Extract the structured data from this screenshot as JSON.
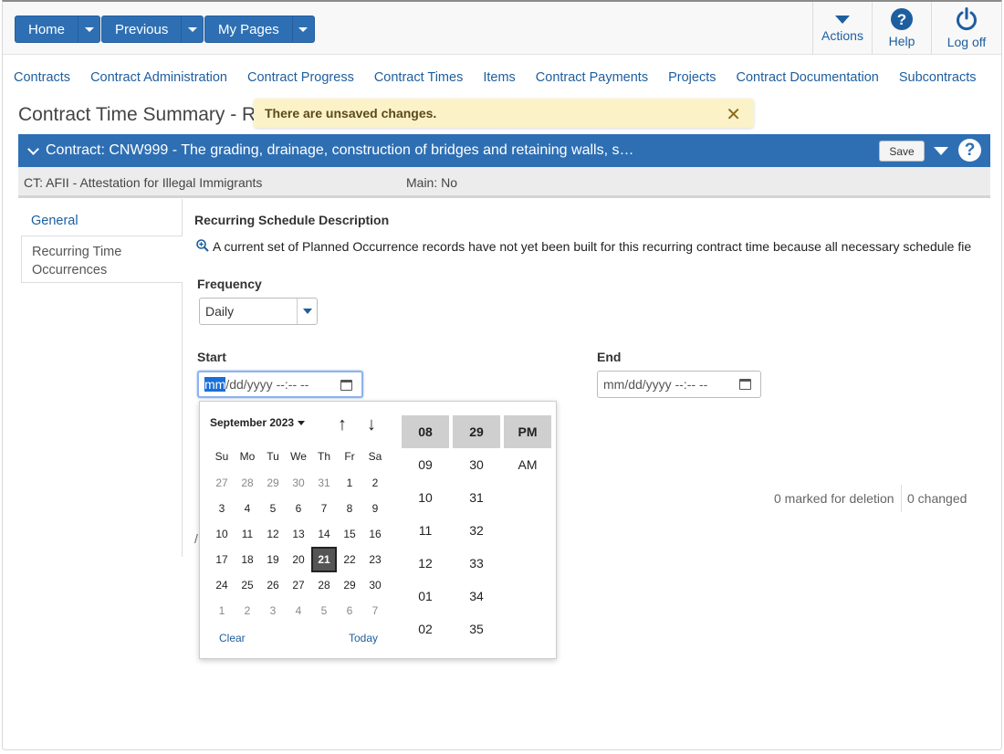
{
  "nav": {
    "home": "Home",
    "previous": "Previous",
    "my_pages": "My Pages",
    "actions": "Actions",
    "help": "Help",
    "logoff": "Log off"
  },
  "menu": [
    "Contracts",
    "Contract Administration",
    "Contract Progress",
    "Contract Times",
    "Items",
    "Contract Payments",
    "Projects",
    "Contract Documentation",
    "Subcontracts"
  ],
  "page_title": "Contract Time Summary - R",
  "toast": {
    "message": "There are unsaved changes.",
    "close": "✕"
  },
  "contract_bar": {
    "title": "Contract: CNW999 - The grading, drainage, construction of bridges and retaining walls, s…",
    "save": "Save",
    "help": "?"
  },
  "subbar": {
    "ct": "CT: AFII - Attestation for Illegal Immigrants",
    "main": "Main: No"
  },
  "side_tabs": [
    "General",
    "Recurring Time Occurrences"
  ],
  "content": {
    "section_label": "Recurring Schedule Description",
    "info_text": "A current set of Planned Occurrence records have not yet been built for this recurring contract time because all necessary schedule fie",
    "frequency_label": "Frequency",
    "frequency_value": "Daily",
    "start_label": "Start",
    "end_label": "End",
    "start_mm": "mm",
    "start_rest": "/dd/yyyy --:-- --",
    "end_placeholder": "mm/dd/yyyy --:-- --",
    "marked_for_deletion": "0 marked for deletion",
    "changed": "0 changed",
    "partial_char": "/"
  },
  "calendar": {
    "month": "September 2023",
    "up_arrow": "↑",
    "down_arrow": "↓",
    "dow": [
      "Su",
      "Mo",
      "Tu",
      "We",
      "Th",
      "Fr",
      "Sa"
    ],
    "weeks": [
      [
        "27",
        "28",
        "29",
        "30",
        "31",
        "1",
        "2"
      ],
      [
        "3",
        "4",
        "5",
        "6",
        "7",
        "8",
        "9"
      ],
      [
        "10",
        "11",
        "12",
        "13",
        "14",
        "15",
        "16"
      ],
      [
        "17",
        "18",
        "19",
        "20",
        "21",
        "22",
        "23"
      ],
      [
        "24",
        "25",
        "26",
        "27",
        "28",
        "29",
        "30"
      ],
      [
        "1",
        "2",
        "3",
        "4",
        "5",
        "6",
        "7"
      ]
    ],
    "selected_day": "21",
    "clear": "Clear",
    "today": "Today",
    "hours": [
      "08",
      "09",
      "10",
      "11",
      "12",
      "01",
      "02"
    ],
    "minutes": [
      "29",
      "30",
      "31",
      "32",
      "33",
      "34",
      "35"
    ],
    "ampm": [
      "PM",
      "AM"
    ]
  },
  "colors": {
    "primary": "#2e6fb4",
    "link": "#1d5e9e",
    "toast_bg": "#fcf2c8"
  }
}
